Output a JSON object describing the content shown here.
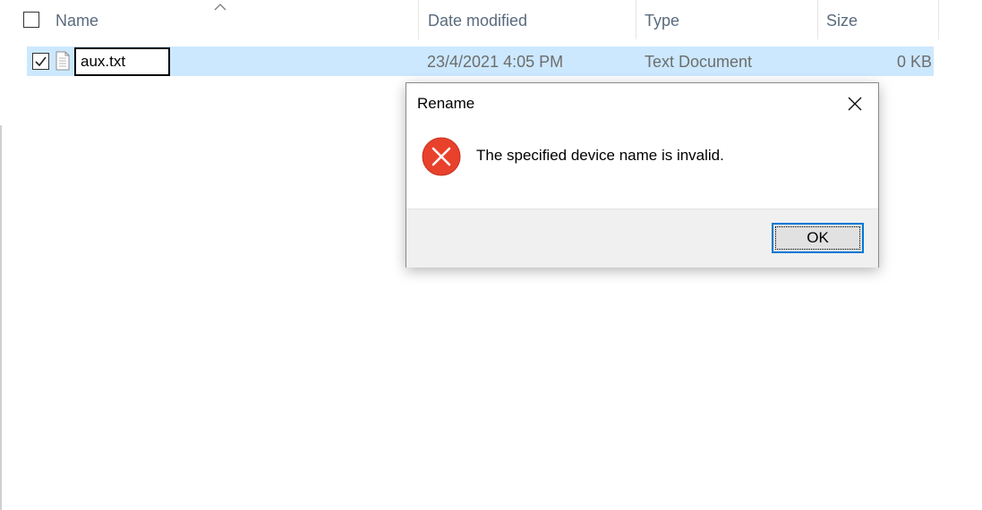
{
  "columns": {
    "name": "Name",
    "date_modified": "Date modified",
    "type": "Type",
    "size": "Size"
  },
  "file_row": {
    "name_value": "aux.txt",
    "date_modified": "23/4/2021 4:05 PM",
    "type": "Text Document",
    "size": "0 KB",
    "selected": true,
    "checked": true
  },
  "dialog": {
    "title": "Rename",
    "message": "The specified device name is invalid.",
    "ok_label": "OK",
    "icon": "error-icon"
  },
  "colors": {
    "selection": "#cce8ff",
    "error_red": "#e8412c",
    "focus_blue": "#0078d7"
  }
}
